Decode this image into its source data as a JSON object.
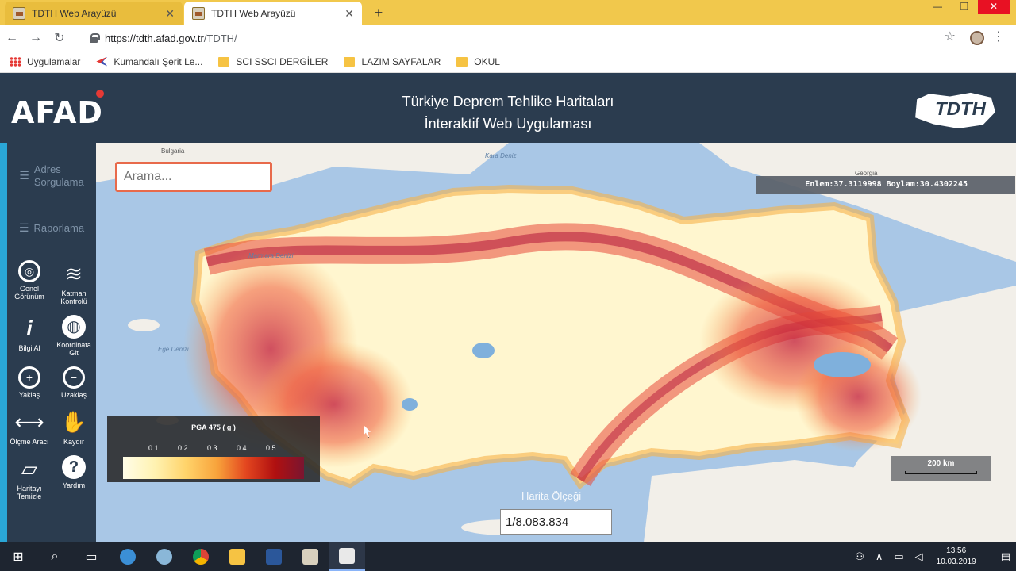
{
  "browser": {
    "tabs": [
      {
        "title": "TDTH Web Arayüzü",
        "active": false
      },
      {
        "title": "TDTH Web Arayüzü",
        "active": true
      }
    ],
    "new_tab": "+",
    "url_host": "https://tdth.afad.gov.tr",
    "url_path": "/TDTH/",
    "bookmarks": [
      {
        "label": "Uygulamalar",
        "icon": "apps-icon"
      },
      {
        "label": "Kumandalı Şerit Le...",
        "icon": "bookmark-icon"
      },
      {
        "label": "SCI SSCI DERGİLER",
        "icon": "folder-icon"
      },
      {
        "label": "LAZIM SAYFALAR",
        "icon": "folder-icon"
      },
      {
        "label": "OKUL",
        "icon": "folder-icon"
      }
    ]
  },
  "header": {
    "logo": "AFAD",
    "title_line1": "Türkiye Deprem Tehlike Haritaları",
    "title_line2": "İnteraktif Web Uygulaması",
    "right_logo": "TDTH"
  },
  "sidebar": {
    "menu": [
      {
        "label_line1": "Adres",
        "label_line2": "Sorgulama"
      },
      {
        "label_line1": "Raporlama",
        "label_line2": ""
      }
    ],
    "tools": [
      {
        "label": "Genel Görünüm",
        "icon": "target-icon"
      },
      {
        "label": "Katman Kontrolü",
        "icon": "layers-icon"
      },
      {
        "label": "Bilgi Al",
        "icon": "info-icon"
      },
      {
        "label": "Koordinata Git",
        "icon": "globe-icon"
      },
      {
        "label": "Yaklaş",
        "icon": "zoom-in-icon"
      },
      {
        "label": "Uzaklaş",
        "icon": "zoom-out-icon"
      },
      {
        "label": "Ölçme Aracı",
        "icon": "measure-icon"
      },
      {
        "label": "Kaydır",
        "icon": "hand-icon"
      },
      {
        "label": "Haritayı Temizle",
        "icon": "eraser-icon"
      },
      {
        "label": "Yardım",
        "icon": "help-icon"
      }
    ]
  },
  "map": {
    "search_placeholder": "Arama...",
    "coords": "Enlem:37.3119998 Boylam:30.4302245",
    "legend_title": "PGA 475 ( g )",
    "legend_ticks": [
      "0.1",
      "0.2",
      "0.3",
      "0.4",
      "0.5"
    ],
    "scale_bar": "200 km",
    "scale_title": "Harita Ölçeği",
    "scale_ratio": "1/8.083.834",
    "labels": {
      "bulgaria": "Bulgaria",
      "karadeniz": "Kara Deniz",
      "georgia": "Georgia",
      "marmara": "Marmara Denizi",
      "ege": "Ege Denizi"
    }
  },
  "taskbar": {
    "time": "13:56",
    "date": "10.03.2019"
  }
}
